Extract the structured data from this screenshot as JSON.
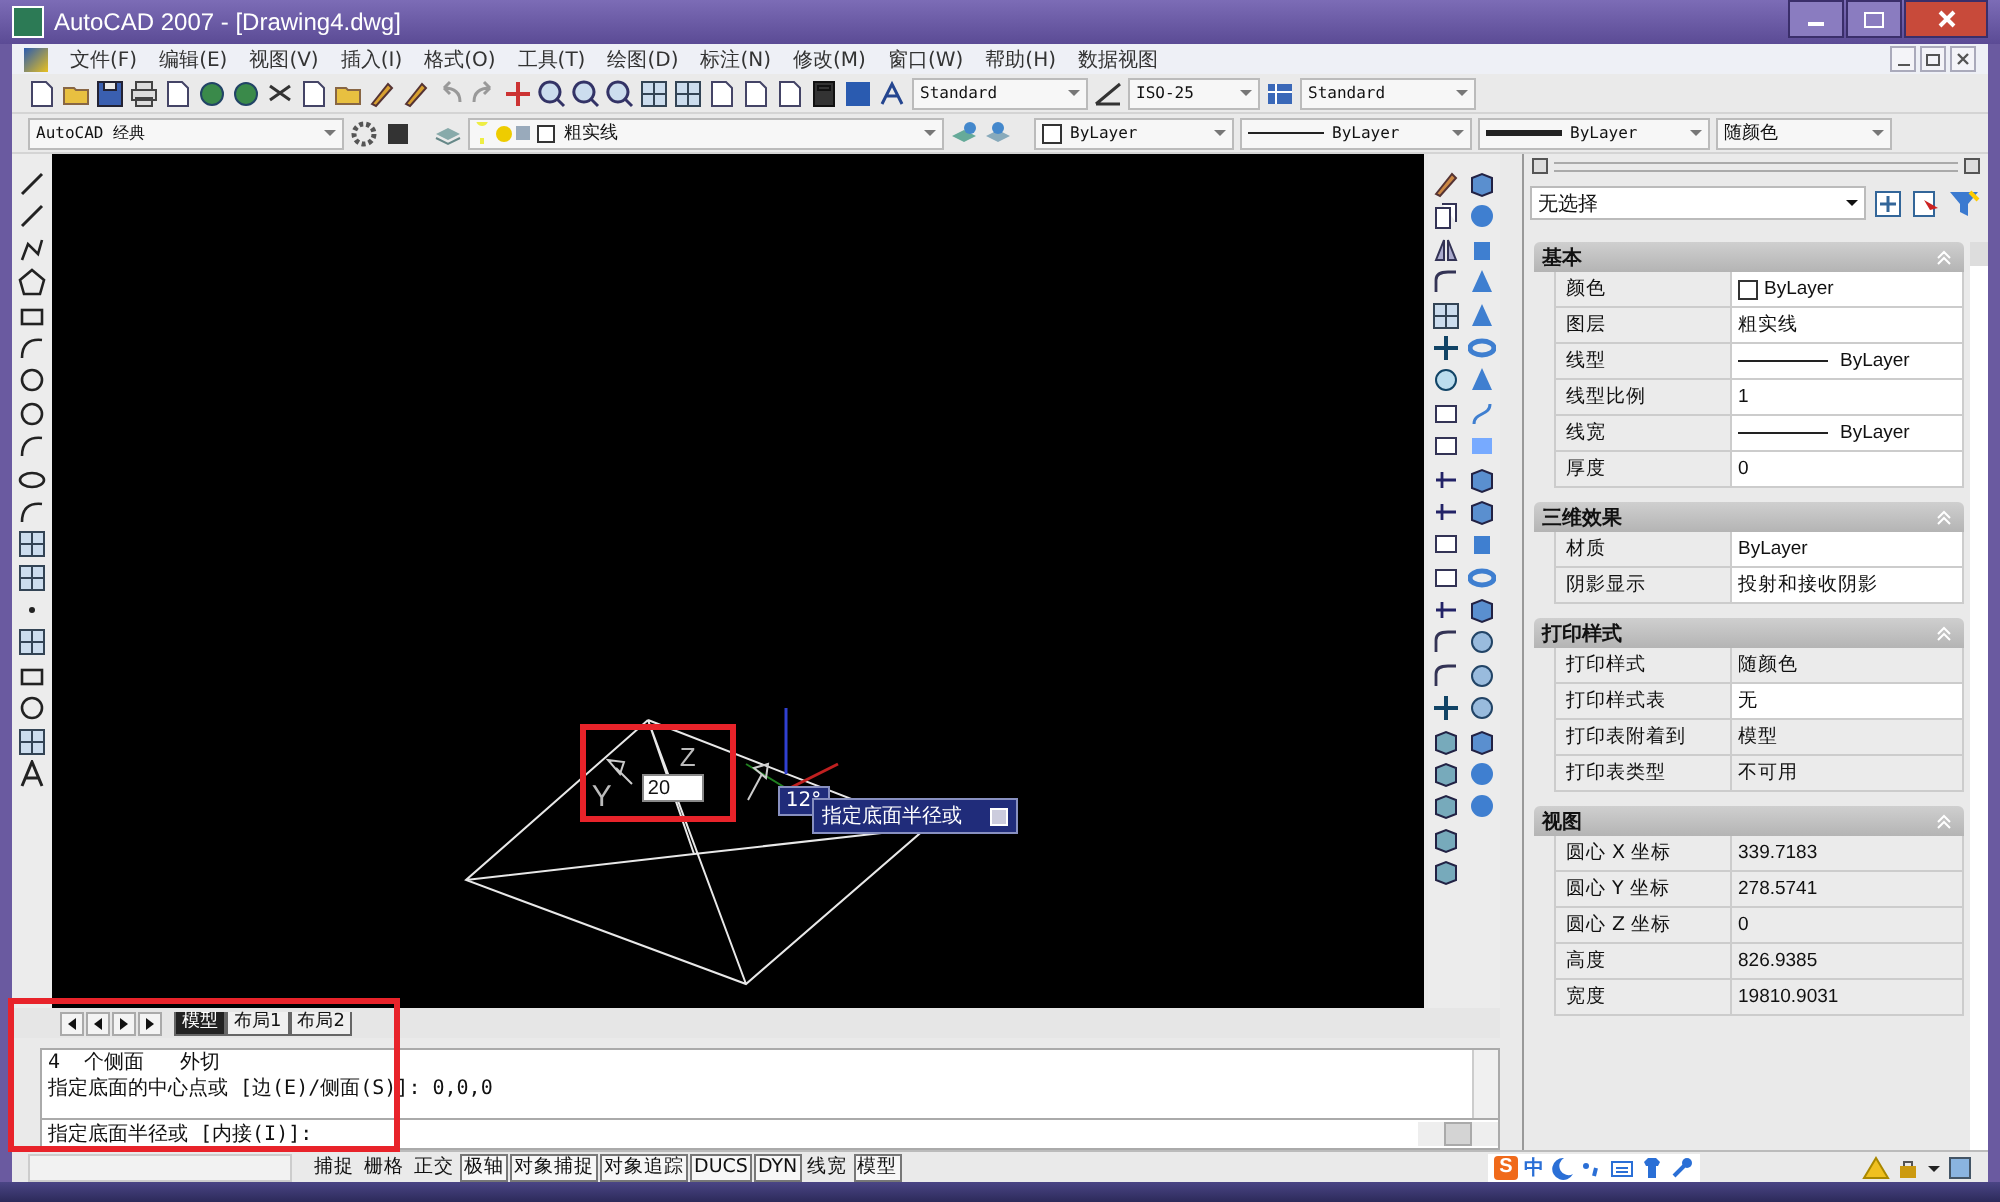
{
  "window": {
    "title": "AutoCAD 2007 - [Drawing4.dwg]"
  },
  "menu": [
    "文件(F)",
    "编辑(E)",
    "视图(V)",
    "插入(I)",
    "格式(O)",
    "工具(T)",
    "绘图(D)",
    "标注(N)",
    "修改(M)",
    "窗口(W)",
    "帮助(H)",
    "数据视图"
  ],
  "styles_toolbar": {
    "text_style": "Standard",
    "dim_style": "ISO-25",
    "table_style": "Standard"
  },
  "workspace": "AutoCAD 经典",
  "layer": "粗实线",
  "properties_toolbar": {
    "color_control": "ByLayer",
    "linetype": "ByLayer",
    "lineweight": "ByLayer",
    "plot_style": "随颜色"
  },
  "canvas": {
    "axis_z": "Z",
    "axis_y": "Y",
    "input_value": "20",
    "angle": "12°",
    "prompt": "指定底面半径或"
  },
  "layout_tabs": [
    {
      "label": "模型",
      "selected": true
    },
    {
      "label": "布局1",
      "selected": false
    },
    {
      "label": "布局2",
      "selected": false
    }
  ],
  "command_lines": [
    "4  个侧面   外切",
    "指定底面的中心点或 [边(E)/侧面(S)]: 0,0,0"
  ],
  "command_prompt": "指定底面半径或 [内接(I)]:",
  "status_toggles": [
    {
      "label": "捕捉",
      "on": false
    },
    {
      "label": "栅格",
      "on": false
    },
    {
      "label": "正交",
      "on": false
    },
    {
      "label": "极轴",
      "on": true
    },
    {
      "label": "对象捕捉",
      "on": true
    },
    {
      "label": "对象追踪",
      "on": true
    },
    {
      "label": "DUCS",
      "on": true
    },
    {
      "label": "DYN",
      "on": true
    },
    {
      "label": "线宽",
      "on": false
    },
    {
      "label": "模型",
      "on": true
    }
  ],
  "ime": {
    "logo": "S",
    "mode": "中"
  },
  "properties_panel": {
    "selection": "无选择",
    "sections": [
      {
        "title": "基本",
        "rows": [
          {
            "label": "颜色",
            "value": "ByLayer",
            "kind": "swatch",
            "editable": true
          },
          {
            "label": "图层",
            "value": "粗实线",
            "kind": "text",
            "editable": true
          },
          {
            "label": "线型",
            "value": "ByLayer",
            "kind": "line",
            "editable": true
          },
          {
            "label": "线型比例",
            "value": "1",
            "kind": "text",
            "editable": true
          },
          {
            "label": "线宽",
            "value": "ByLayer",
            "kind": "line",
            "editable": true
          },
          {
            "label": "厚度",
            "value": "0",
            "kind": "text",
            "editable": true
          }
        ]
      },
      {
        "title": "三维效果",
        "rows": [
          {
            "label": "材质",
            "value": "ByLayer",
            "kind": "text",
            "editable": true
          },
          {
            "label": "阴影显示",
            "value": "投射和接收阴影",
            "kind": "text",
            "editable": true
          }
        ]
      },
      {
        "title": "打印样式",
        "rows": [
          {
            "label": "打印样式",
            "value": "随颜色",
            "kind": "text",
            "editable": false
          },
          {
            "label": "打印样式表",
            "value": "无",
            "kind": "text",
            "editable": true
          },
          {
            "label": "打印表附着到",
            "value": "模型",
            "kind": "text",
            "editable": false
          },
          {
            "label": "打印表类型",
            "value": "不可用",
            "kind": "text",
            "editable": false
          }
        ]
      },
      {
        "title": "视图",
        "rows": [
          {
            "label": "圆心 X 坐标",
            "value": "339.7183",
            "kind": "text",
            "editable": false
          },
          {
            "label": "圆心 Y 坐标",
            "value": "278.5741",
            "kind": "text",
            "editable": false
          },
          {
            "label": "圆心 Z 坐标",
            "value": "0",
            "kind": "text",
            "editable": false
          },
          {
            "label": "高度",
            "value": "826.9385",
            "kind": "text",
            "editable": false
          },
          {
            "label": "宽度",
            "value": "19810.9031",
            "kind": "text",
            "editable": false
          }
        ]
      }
    ]
  }
}
